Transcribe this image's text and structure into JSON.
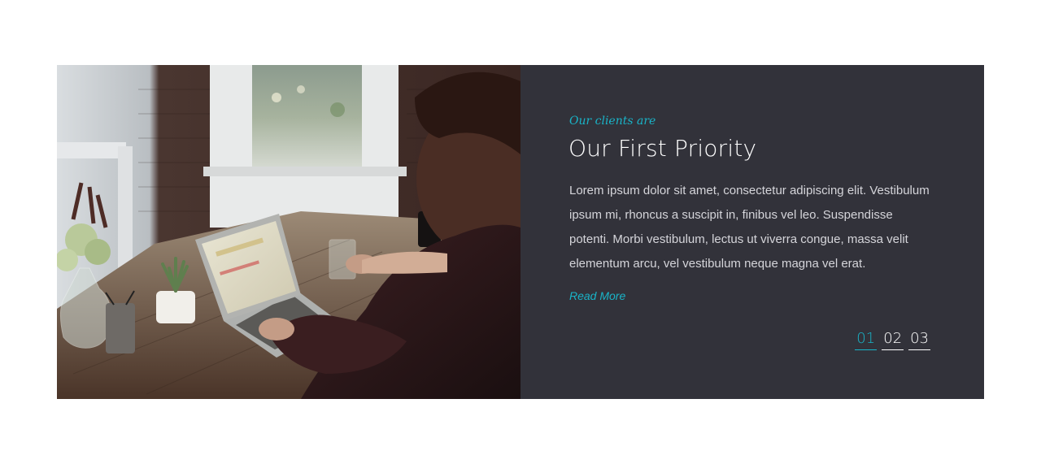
{
  "slide": {
    "image_alt": "Man working on a laptop at a wooden desk near a window",
    "eyebrow": "Our clients are",
    "title": "Our First Priority",
    "body": "Lorem ipsum dolor sit amet, consectetur adipiscing elit. Vestibulum ipsum mi, rhoncus a suscipit in, finibus vel leo. Suspendisse potenti. Morbi vestibulum, lectus ut viverra congue, massa velit elementum arcu, vel vestibulum neque magna vel erat.",
    "read_more": "Read More"
  },
  "pager": {
    "items": [
      "01",
      "02",
      "03"
    ],
    "active_index": 0
  },
  "colors": {
    "accent": "#19b4c8",
    "panel_bg": "#32323a",
    "text_light": "#d5d5da"
  }
}
